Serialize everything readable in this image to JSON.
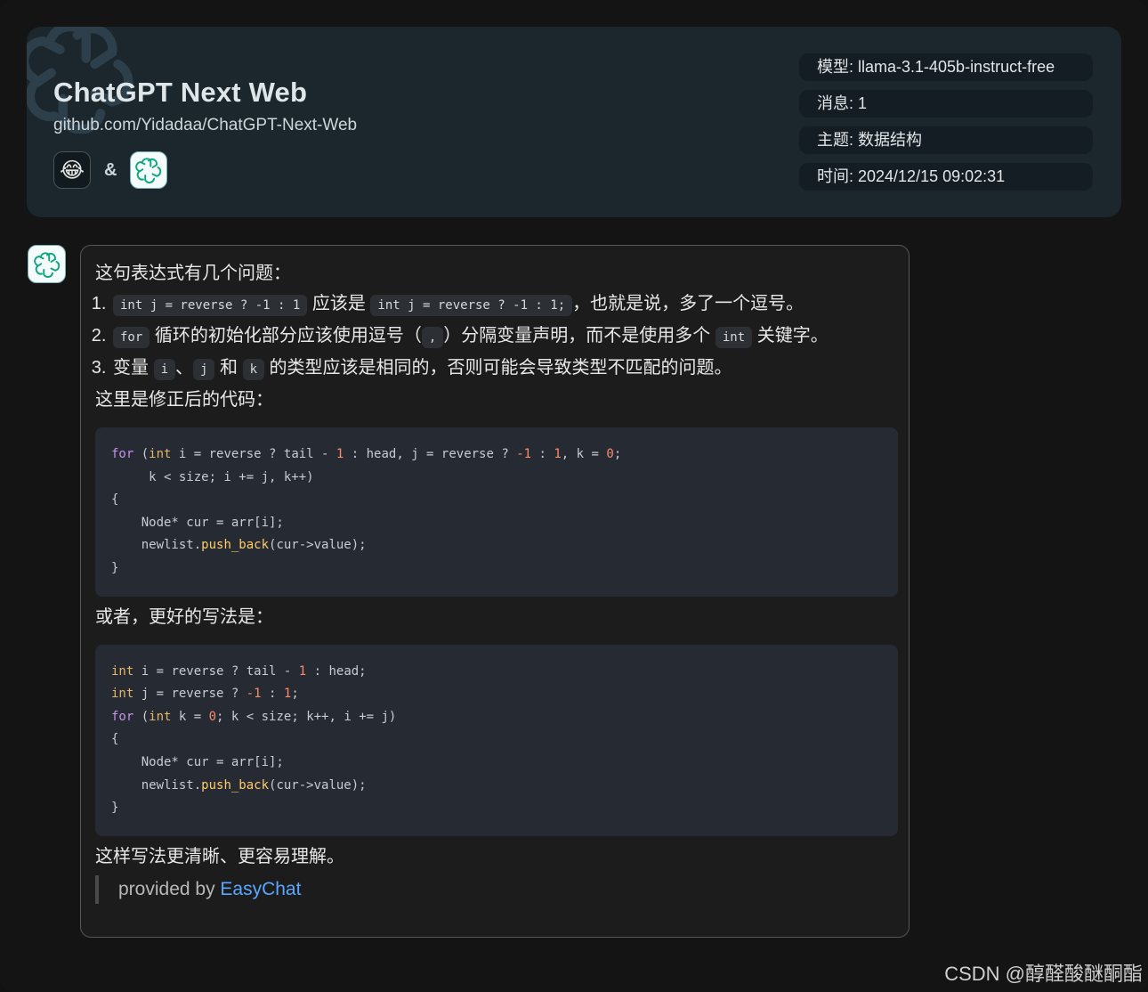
{
  "header": {
    "title": "ChatGPT Next Web",
    "subtitle": "github.com/Yidadaa/ChatGPT-Next-Web",
    "user_avatar_emoji": "😂",
    "ampersand": "&",
    "bot_icon": "openai-logo-icon"
  },
  "meta": {
    "model": "模型: llama-3.1-405b-instruct-free",
    "messages": "消息: 1",
    "topic": "主题: 数据结构",
    "time": "时间: 2024/12/15 09:02:31"
  },
  "message": {
    "intro": "这句表达式有几个问题：",
    "items": [
      {
        "code1": "int j = reverse ? -1 : 1",
        "text1": " 应该是 ",
        "code2": "int j = reverse ? -1 : 1;",
        "text2": "，也就是说，多了一个逗号。"
      },
      {
        "code1": "for",
        "text1": " 循环的初始化部分应该使用逗号（",
        "code2": ",",
        "text2": "）分隔变量声明，而不是使用多个 ",
        "code3": "int",
        "text3": " 关键字。"
      },
      {
        "text0": "变量 ",
        "code1": "i",
        "text1": "、",
        "code2": "j",
        "text2": " 和 ",
        "code3": "k",
        "text3": " 的类型应该是相同的，否则可能会导致类型不匹配的问题。"
      }
    ],
    "fixed_label": "这里是修正后的代码：",
    "code_block_1": [
      "for (int i = reverse ? tail - 1 : head, j = reverse ? -1 : 1, k = 0;",
      "     k < size; i += j, k++)",
      "{",
      "    Node* cur = arr[i];",
      "    newlist.push_back(cur->value);",
      "}"
    ],
    "better_label": "或者，更好的写法是：",
    "code_block_2": [
      "int i = reverse ? tail - 1 : head;",
      "int j = reverse ? -1 : 1;",
      "for (int k = 0; k < size; k++, i += j)",
      "{",
      "    Node* cur = arr[i];",
      "    newlist.push_back(cur->value);",
      "}"
    ],
    "conclusion": "这样写法更清晰、更容易理解。",
    "provided_prefix": "provided by ",
    "provided_link": "EasyChat"
  },
  "watermark": "CSDN @醇醛酸醚酮酯",
  "colors": {
    "background": "#141414",
    "header_bg": "#1b262d",
    "bubble_border": "#565656",
    "code_bg": "#262a33",
    "link": "#5aa7ff"
  }
}
